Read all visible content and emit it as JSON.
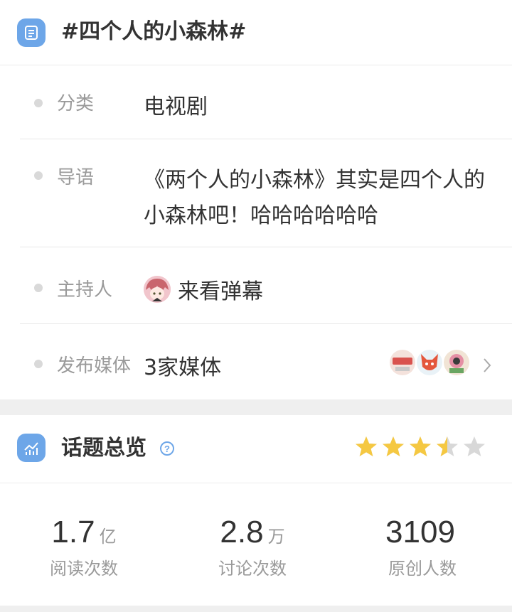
{
  "topic": {
    "title": "#四个人的小森林#",
    "icon": "list-icon"
  },
  "details": {
    "category_label": "分类",
    "category_value": "电视剧",
    "intro_label": "导语",
    "intro_value": "《两个人的小森林》其实是四个人的小森林吧！哈哈哈哈哈哈",
    "host_label": "主持人",
    "host_name": "来看弹幕",
    "media_label": "发布媒体",
    "media_value": "3家媒体"
  },
  "overview": {
    "title": "话题总览",
    "rating_stars": 3.5,
    "stats": [
      {
        "num": "1.7",
        "unit": "亿",
        "caption": "阅读次数"
      },
      {
        "num": "2.8",
        "unit": "万",
        "caption": "讨论次数"
      },
      {
        "num": "3109",
        "unit": "",
        "caption": "原创人数"
      }
    ]
  },
  "colors": {
    "accent": "#6da6e8",
    "star": "#f5c842",
    "star_empty": "#d8d8d8"
  }
}
